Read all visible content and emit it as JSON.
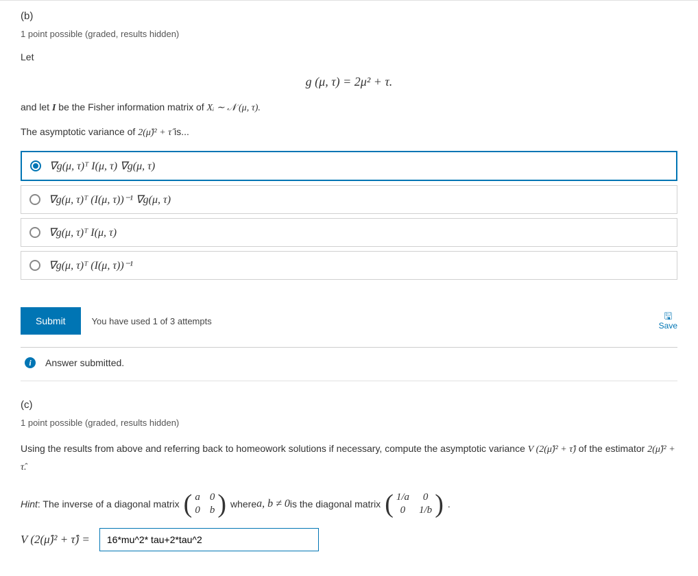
{
  "part_b": {
    "label": "(b)",
    "points": "1 point possible (graded, results hidden)",
    "let": "Let",
    "equation": "g (μ, τ) = 2μ² + τ.",
    "and_let_pre": "and let ",
    "and_let_bold": "I",
    "and_let_mid": " be the Fisher information matrix of ",
    "and_let_math": "Xᵢ ∼ 𝒩 (μ, τ).",
    "asymp_pre": "The asymptotic variance of ",
    "asymp_math": "2(μ̂)² + τ̂",
    "asymp_post": " is...",
    "choices": [
      "∇g(μ, τ)ᵀ I(μ, τ) ∇g(μ, τ)",
      "∇g(μ, τ)ᵀ (I(μ, τ))⁻¹ ∇g(μ, τ)",
      "∇g(μ, τ)ᵀ I(μ, τ)",
      "∇g(μ, τ)ᵀ (I(μ, τ))⁻¹"
    ],
    "selected": 0,
    "submit": "Submit",
    "attempts": "You have used 1 of 3 attempts",
    "save": "Save",
    "status": "Answer submitted."
  },
  "part_c": {
    "label": "(c)",
    "points": "1 point possible (graded, results hidden)",
    "prompt_pre": "Using the results from above and referring back to homeowork solutions if necessary, compute the asymptotic variance ",
    "prompt_v": "V (2(μ̂)² + τ̂)",
    "prompt_mid": " of the estimator ",
    "prompt_est": "2(μ̂)² + τ̂.",
    "hint_label": "Hint",
    "hint_pre": ": The inverse of a diagonal matrix ",
    "matrix1": {
      "a": "a",
      "b": "0",
      "c": "0",
      "d": "b"
    },
    "hint_mid1": " where ",
    "hint_ab": "a, b ≠ 0",
    "hint_mid2": " is the diagonal matrix ",
    "matrix2": {
      "a": "1/a",
      "b": "0",
      "c": "0",
      "d": "1/b"
    },
    "hint_end": ".",
    "answer_label": "V (2(μ̂)² + τ̂)  =",
    "answer_value": "16*mu^2* tau+2*tau^2"
  }
}
